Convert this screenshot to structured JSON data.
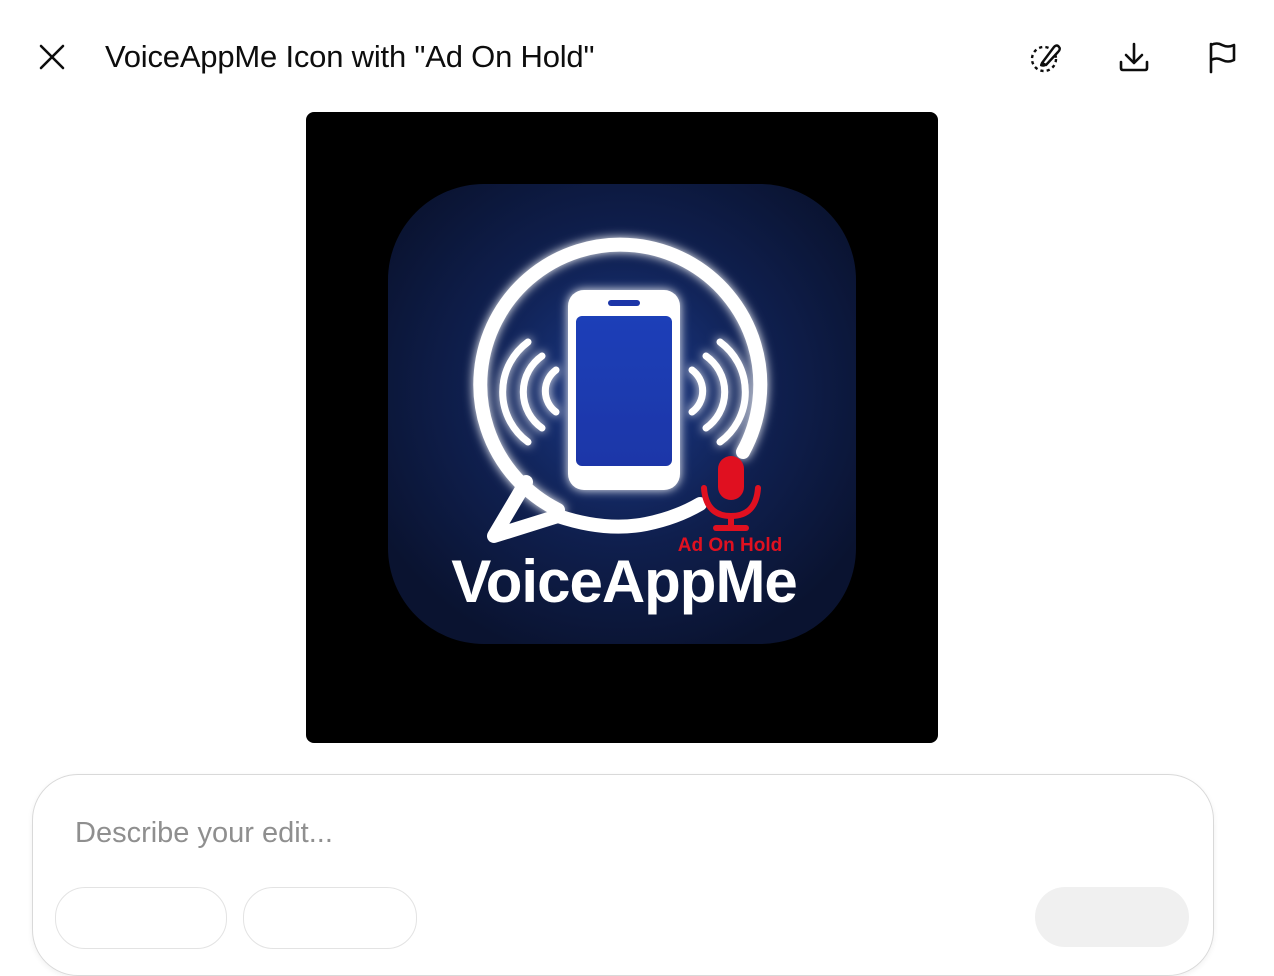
{
  "header": {
    "title": "VoiceAppMe Icon with \"Ad On Hold\"",
    "close_icon": "close-icon",
    "select_icon": "select-edit-icon",
    "download_icon": "download-icon",
    "report_icon": "flag-icon"
  },
  "image": {
    "brand_text": "VoiceAppMe",
    "badge_text": "Ad On Hold",
    "colors": {
      "background": "#000000",
      "tile": "#0d1a3a",
      "phone_screen": "#1a3fc4",
      "outline": "#ffffff",
      "mic": "#e01020"
    }
  },
  "composer": {
    "placeholder": "Describe your edit..."
  }
}
